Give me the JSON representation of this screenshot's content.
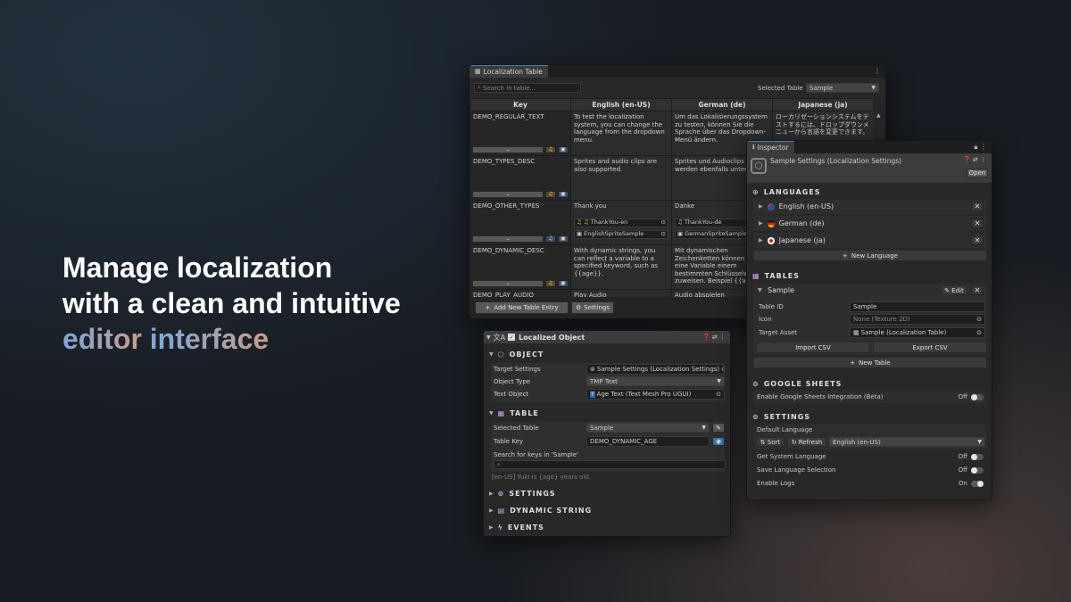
{
  "hero": {
    "line1": "Manage localization",
    "line2": "with a clean and intuitive",
    "line3_a": "editor",
    "line3_b": "interface"
  },
  "colors": {
    "accent_blue": "#4a7ab8",
    "hero_gradient_start": "#7fa6d9",
    "hero_gradient_end": "#c79e8c"
  },
  "localization_table": {
    "tab_title": "Localization Table",
    "search_placeholder": "Search in table...",
    "selected_table_label": "Selected Table",
    "selected_table_value": "Sample",
    "columns": [
      "Key",
      "English (en-US)",
      "German (de)",
      "Japanese (ja)"
    ],
    "rows": [
      {
        "key": "DEMO_REGULAR_TEXT",
        "en": "To test the localization system, you can change the language from the dropdown menu.",
        "de": "Um das Lokalisierungssystem zu testen, können Sie die Sprache über das Dropdown-Menü ändern.",
        "ja": "ローカリゼーションシステムをテストするには、ドロップダウンメニューから言語を変更できます。"
      },
      {
        "key": "DEMO_TYPES_DESC",
        "en": "Sprites and audio clips are also supported.",
        "de": "Sprites und Audioclips werden ebenfalls unterstützt.",
        "ja": ""
      },
      {
        "key": "DEMO_OTHER_TYPES",
        "en": "Thank you",
        "de": "Danke",
        "ja": "",
        "en_audio": "ThankYou-en",
        "en_sprite": "EnglishSpriteSample",
        "de_audio": "ThankYou-de",
        "de_sprite": "GermanSpriteSample"
      },
      {
        "key": "DEMO_DYNAMIC_DESC",
        "en": "With dynamic strings, you can reflect a variable to a specified keyword, such as {{age}}.",
        "de": "Mit dynamischen Zeichenketten können Sie eine Variable einem bestimmten Schlüsselwort zuweisen. Beispiel {{age}}.",
        "ja": ""
      },
      {
        "key": "DEMO_PLAY_AUDIO",
        "en": "Play Audio",
        "de": "Audio abspielen",
        "ja": ""
      }
    ],
    "add_entry_label": "Add New Table Entry",
    "settings_label": "Settings",
    "minus_label": "–"
  },
  "localized_object": {
    "tab_title": "Localized Object",
    "sections": {
      "object": "OBJECT",
      "table": "TABLE",
      "settings": "SETTINGS",
      "dynamic_string": "DYNAMIC STRING",
      "events": "EVENTS"
    },
    "target_settings_label": "Target Settings",
    "target_settings_value": "Sample Settings (Localization Settings)",
    "object_type_label": "Object Type",
    "object_type_value": "TMP Text",
    "text_object_label": "Text Object",
    "text_object_value": "Age Text (Text Mesh Pro UGUI)",
    "selected_table_label": "Selected Table",
    "selected_table_value": "Sample",
    "table_key_label": "Table Key",
    "table_key_value": "DEMO_DYNAMIC_AGE",
    "search_keys_label": "Search for keys in 'Sample'",
    "preview_text": "[en-US] Yuki is {age} years old."
  },
  "inspector": {
    "tab_title": "Inspector",
    "asset_title": "Sample Settings (Localization Settings)",
    "open_label": "Open",
    "languages_header": "LANGUAGES",
    "languages": [
      {
        "name": "English (en-US)",
        "flag": "us"
      },
      {
        "name": "German (de)",
        "flag": "de"
      },
      {
        "name": "Japanese (ja)",
        "flag": "jp"
      }
    ],
    "new_language_label": "New Language",
    "tables_header": "TABLES",
    "table_name": "Sample",
    "edit_label": "Edit",
    "table_id_label": "Table ID",
    "table_id_value": "Sample",
    "icon_label": "Icon",
    "icon_value": "None (Texture 2D)",
    "target_asset_label": "Target Asset",
    "target_asset_value": "Sample (Localization Table)",
    "import_csv_label": "Import CSV",
    "export_csv_label": "Export CSV",
    "new_table_label": "New Table",
    "google_sheets_header": "GOOGLE SHEETS",
    "google_sheets_label": "Enable Google Sheets Integration (Beta)",
    "google_sheets_state": "Off",
    "settings_header": "SETTINGS",
    "default_language_label": "Default Language",
    "sort_label": "Sort",
    "refresh_label": "Refresh",
    "default_language_value": "English (en-US)",
    "get_system_language_label": "Get System Language",
    "get_system_language_state": "Off",
    "save_language_label": "Save Language Selection",
    "save_language_state": "Off",
    "enable_logs_label": "Enable Logs",
    "enable_logs_state": "On",
    "x_label": "✕"
  }
}
